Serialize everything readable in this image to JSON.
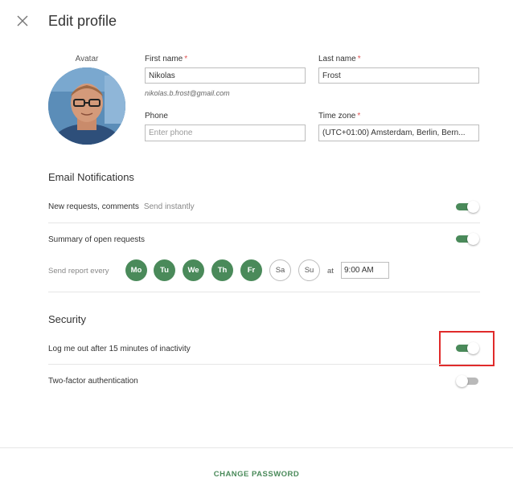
{
  "header": {
    "title": "Edit profile"
  },
  "avatar": {
    "label": "Avatar"
  },
  "form": {
    "first_name_label": "First name",
    "first_name_value": "Nikolas",
    "last_name_label": "Last name",
    "last_name_value": "Frost",
    "required_mark": "*",
    "email": "nikolas.b.frost@gmail.com",
    "phone_label": "Phone",
    "phone_placeholder": "Enter phone",
    "phone_value": "",
    "timezone_label": "Time zone",
    "timezone_value": "(UTC+01:00) Amsterdam, Berlin, Bern..."
  },
  "notifications": {
    "title": "Email Notifications",
    "new_requests_label": "New requests, comments",
    "new_requests_sub": "Send instantly",
    "new_requests_on": true,
    "summary_label": "Summary of open requests",
    "summary_on": true,
    "report_label": "Send report every",
    "days": [
      {
        "label": "Mo",
        "selected": true
      },
      {
        "label": "Tu",
        "selected": true
      },
      {
        "label": "We",
        "selected": true
      },
      {
        "label": "Th",
        "selected": true
      },
      {
        "label": "Fr",
        "selected": true
      },
      {
        "label": "Sa",
        "selected": false
      },
      {
        "label": "Su",
        "selected": false
      }
    ],
    "at_label": "at",
    "time_value": "9:00 AM"
  },
  "security": {
    "title": "Security",
    "logout_label": "Log me out after 15 minutes of inactivity",
    "logout_on": true,
    "twofa_label": "Two-factor authentication",
    "twofa_on": false
  },
  "footer": {
    "change_password": "CHANGE PASSWORD"
  },
  "colors": {
    "accent": "#4a8a5a",
    "required": "#e05252",
    "highlight": "#e02b2b",
    "toggle_off": "#b9b9b9"
  }
}
